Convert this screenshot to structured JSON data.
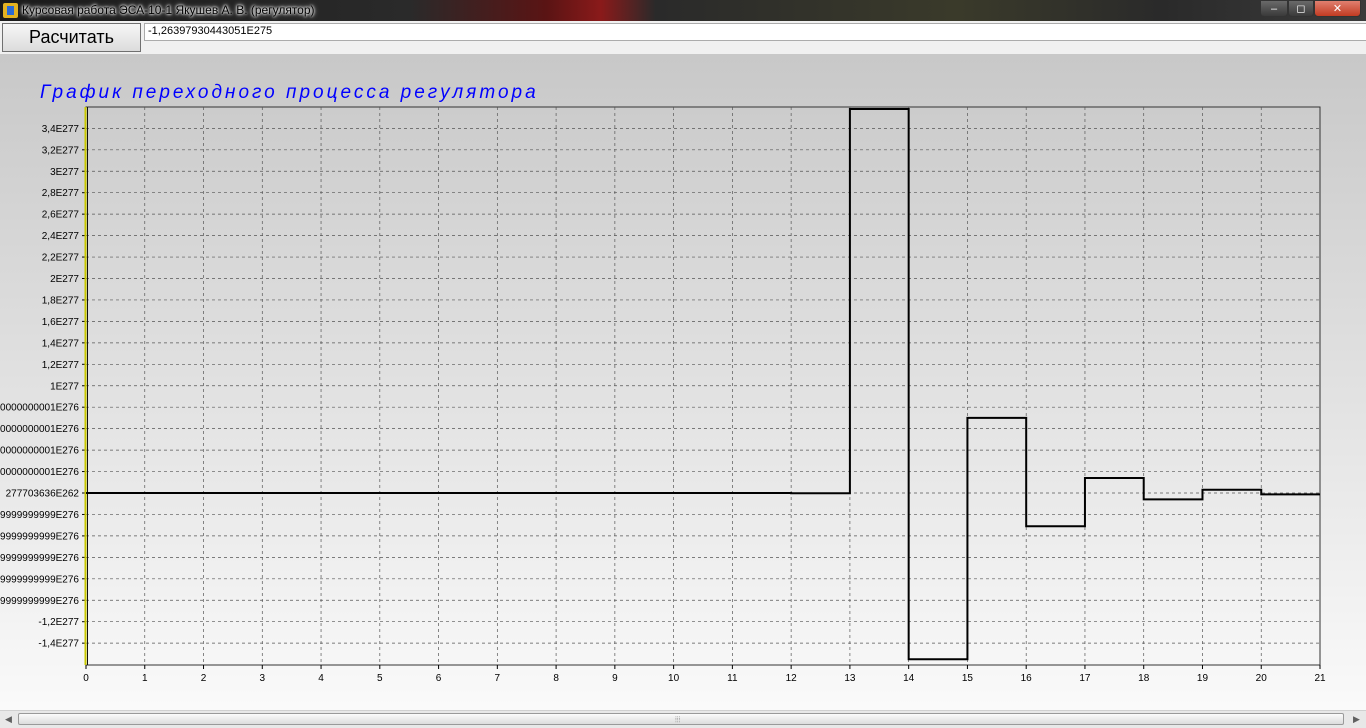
{
  "window": {
    "title": "Курсовая работа ЭСА-10-1 Якушев А. В. (регулятор)",
    "icon": "app-icon",
    "controls": {
      "minimize": "‒",
      "maximize": "◻",
      "close": "✕"
    }
  },
  "toolbar": {
    "calculate_label": "Расчитать",
    "result_value": "-1,26397930443051E275"
  },
  "colors": {
    "title": "#0000ff",
    "grid": "#555555",
    "line": "#000000",
    "axis_left": "#c8c800"
  },
  "chart_data": {
    "type": "line",
    "step": true,
    "title": "График переходного процесса регулятора",
    "xlabel": "",
    "ylabel": "",
    "grid": true,
    "xlim": [
      0,
      21
    ],
    "ylim": [
      -1.5e+277,
      3.5e+277
    ],
    "x_ticks": [
      "0",
      "1",
      "2",
      "3",
      "4",
      "5",
      "6",
      "7",
      "8",
      "9",
      "10",
      "11",
      "12",
      "13",
      "14",
      "15",
      "16",
      "17",
      "18",
      "19",
      "20",
      "21"
    ],
    "y_ticks": [
      {
        "value": 3.4e+277,
        "label": "3,4E277"
      },
      {
        "value": 3.2e+277,
        "label": "3,2E277"
      },
      {
        "value": 3e+277,
        "label": "3E277"
      },
      {
        "value": 2.8e+277,
        "label": "2,8E277"
      },
      {
        "value": 2.6e+277,
        "label": "2,6E277"
      },
      {
        "value": 2.4e+277,
        "label": "2,4E277"
      },
      {
        "value": 2.2e+277,
        "label": "2,2E277"
      },
      {
        "value": 2e+277,
        "label": "2E277"
      },
      {
        "value": 1.8e+277,
        "label": "1,8E277"
      },
      {
        "value": 1.6e+277,
        "label": "1,6E277"
      },
      {
        "value": 1.4e+277,
        "label": "1,4E277"
      },
      {
        "value": 1.2e+277,
        "label": "1,2E277"
      },
      {
        "value": 1e+277,
        "label": "1E277"
      },
      {
        "value": 8e+276,
        "label": "0000000001E276"
      },
      {
        "value": 6e+276,
        "label": "0000000001E276"
      },
      {
        "value": 4e+276,
        "label": "0000000001E276"
      },
      {
        "value": 2e+276,
        "label": "0000000001E276"
      },
      {
        "value": 0,
        "label": "277703636E262"
      },
      {
        "value": -2e+276,
        "label": "9999999999E276"
      },
      {
        "value": -4e+276,
        "label": "9999999999E276"
      },
      {
        "value": -6e+276,
        "label": "9999999999E276"
      },
      {
        "value": -8e+276,
        "label": "9999999999E276"
      },
      {
        "value": -1e+277,
        "label": "9999999999E276"
      },
      {
        "value": -1.2e+277,
        "label": "-1,2E277"
      },
      {
        "value": -1.4e+277,
        "label": "-1,4E277"
      }
    ],
    "series": [
      {
        "x": [
          0,
          12,
          13,
          14,
          15,
          16,
          17,
          18,
          19,
          20,
          21
        ],
        "y": [
          0,
          -2e+274,
          3.58e+277,
          -1.55e+277,
          7e+276,
          -3.1e+276,
          1.4e+276,
          -6e+275,
          3e+275,
          -1.3e+275,
          -1.3e+275
        ]
      }
    ]
  },
  "scrollbar": {
    "grip": "⦙⦙⦙",
    "left_arrow": "◀",
    "right_arrow": "▶"
  }
}
